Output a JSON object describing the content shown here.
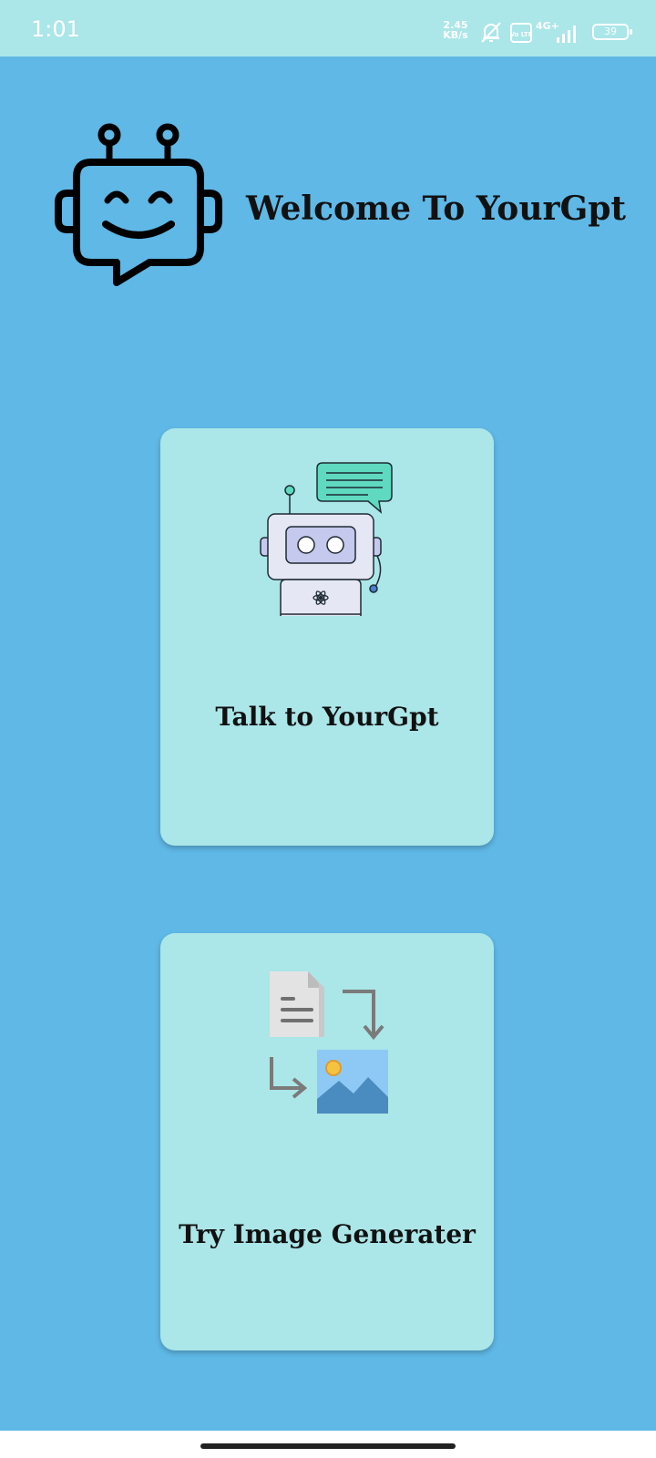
{
  "status_bar": {
    "time": "1:01",
    "net_speed_value": "2.45",
    "net_speed_unit": "KB/s",
    "volte_label": "Vo LTE",
    "network_type": "4G+",
    "battery_level": "39",
    "icons": [
      "bell-off-icon",
      "volte-icon",
      "signal-icon",
      "battery-icon"
    ]
  },
  "header": {
    "logo_icon": "chatbot-icon",
    "title": "Welcome To YourGpt"
  },
  "cards": [
    {
      "icon": "robot-chat-icon",
      "label": "Talk to YourGpt"
    },
    {
      "icon": "text-to-image-icon",
      "label": "Try Image Generater"
    }
  ],
  "colors": {
    "background": "#5fb8e6",
    "status_bar": "#abe6e8",
    "card": "#abe6e8",
    "text": "#111111",
    "chat_bubble": "#5fd9c0"
  }
}
